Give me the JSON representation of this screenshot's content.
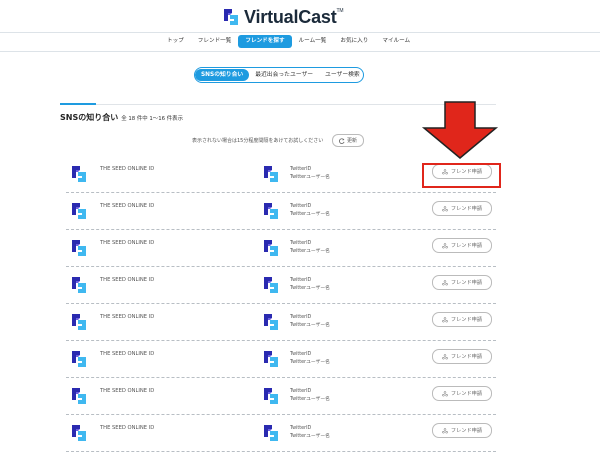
{
  "brand": {
    "name": "VirtualCast",
    "tm": "TM"
  },
  "nav": {
    "items": [
      "トップ",
      "フレンド一覧",
      "フレンドを探す",
      "ルーム一覧",
      "お気に入り",
      "マイルーム"
    ],
    "active_index": 2
  },
  "subtabs": {
    "items": [
      "SNSの知り合い",
      "最近出会ったユーザー",
      "ユーザー検索"
    ],
    "active_index": 0
  },
  "section": {
    "title": "SNSの知り合い",
    "count": "全 18 件中 1〜16 件表示"
  },
  "hint": "表示されない場合は15分程度間隔をあけてお試しください",
  "refresh_label": "更新",
  "rows": [
    {
      "seed_id": "THE SEED ONLINE ID",
      "twitter_id": "TwitterID",
      "twitter_name": "Twitterユーザー名",
      "button": "フレンド申請"
    },
    {
      "seed_id": "THE SEED ONLINE ID",
      "twitter_id": "TwitterID",
      "twitter_name": "Twitterユーザー名",
      "button": "フレンド申請"
    },
    {
      "seed_id": "THE SEED ONLINE ID",
      "twitter_id": "TwitterID",
      "twitter_name": "Twitterユーザー名",
      "button": "フレンド申請"
    },
    {
      "seed_id": "THE SEED ONLINE ID",
      "twitter_id": "TwitterID",
      "twitter_name": "Twitterユーザー名",
      "button": "フレンド申請"
    },
    {
      "seed_id": "THE SEED ONLINE ID",
      "twitter_id": "TwitterID",
      "twitter_name": "Twitterユーザー名",
      "button": "フレンド申請"
    },
    {
      "seed_id": "THE SEED ONLINE ID",
      "twitter_id": "TwitterID",
      "twitter_name": "Twitterユーザー名",
      "button": "フレンド申請"
    },
    {
      "seed_id": "THE SEED ONLINE ID",
      "twitter_id": "TwitterID",
      "twitter_name": "Twitterユーザー名",
      "button": "フレンド申請"
    },
    {
      "seed_id": "THE SEED ONLINE ID",
      "twitter_id": "TwitterID",
      "twitter_name": "Twitterユーザー名",
      "button": "フレンド申請"
    }
  ],
  "colors": {
    "accent": "#1e9be0",
    "highlight": "#e0261b",
    "logo_dark": "#2a2ab0",
    "logo_light": "#3fb8f0"
  },
  "icons": {
    "logo": "virtualcast-logo-icon",
    "refresh": "refresh-icon",
    "friend": "friend-request-icon",
    "arrow": "red-down-arrow"
  }
}
